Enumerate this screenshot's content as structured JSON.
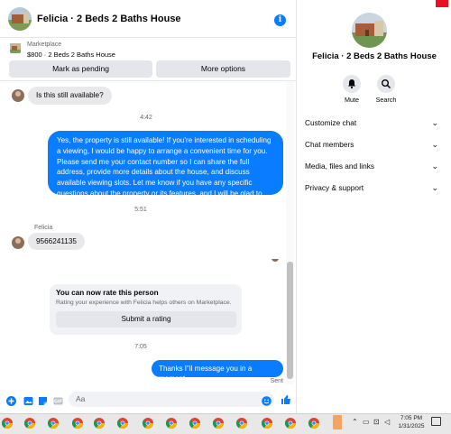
{
  "header": {
    "title": "Felicia · 2 Beds 2 Baths House",
    "info_icon": "i"
  },
  "listing": {
    "kicker": "Marketplace",
    "price_title": "$800 · 2 Beds 2 Baths House",
    "mark_pending_label": "Mark as pending",
    "more_options_label": "More options"
  },
  "messages": {
    "m1": "Is this still available?",
    "ts1": "4:42",
    "m2": "Yes, the property is still available! If you're interested in scheduling a viewing, I would be happy to arrange a convenient time for you. Please send me your contact number so I can share the full address, provide more details about the house, and discuss available viewing slots. Let me know if you have any specific questions about the property or its features, and I will be glad to assist you",
    "ts2": "5:51",
    "sender": "Felicia",
    "m3": "9566241135",
    "ts3": "7:05",
    "m4": "Thanks I\"il message you in a moment",
    "status": "Sent"
  },
  "rate_card": {
    "title": "You can now rate this person",
    "subtitle": "Rating your experience with Felicia helps others on Marketplace.",
    "button": "Submit a rating"
  },
  "composer": {
    "placeholder": "Aa"
  },
  "details": {
    "name": "Felicia · 2 Beds 2 Baths House",
    "mute_label": "Mute",
    "search_label": "Search",
    "sections": [
      "Customize chat",
      "Chat members",
      "Media, files and links",
      "Privacy & support"
    ]
  },
  "taskbar": {
    "time": "7:05 PM",
    "date": "1/31/2025"
  },
  "colors": {
    "accent": "#0a7cff",
    "bubble_in": "#e9e9eb",
    "button_bg": "#e4e6eb"
  }
}
